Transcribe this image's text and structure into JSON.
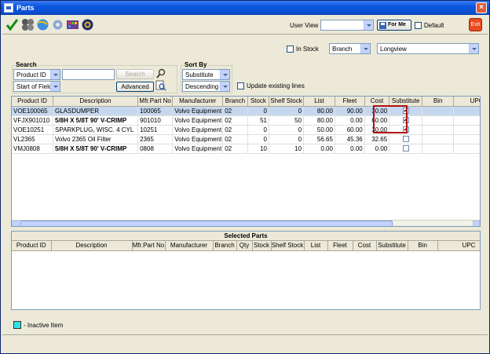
{
  "window": {
    "title": "Parts",
    "close": "×"
  },
  "toolbar": {
    "icons": [
      "check-icon",
      "coins-icon",
      "globe-icon",
      "gear-icon",
      "palette-icon",
      "color-wheel-icon"
    ],
    "user_view_label": "User View",
    "user_view_value": "",
    "for_me_label": "For Me",
    "default_label": "Default",
    "exit_label": "Exit"
  },
  "filter": {
    "in_stock_label": "In Stock",
    "branch_value": "Branch",
    "view_value": "Longview"
  },
  "search": {
    "title": "Search",
    "field_value": "Product ID",
    "match_value": "Start of Field",
    "query_value": "",
    "search_button": "Search",
    "advanced_button": "Advanced"
  },
  "sort": {
    "title": "Sort By",
    "field_value": "Substitute",
    "order_value": "Descending",
    "update_label": "Update existing lines"
  },
  "results": {
    "columns": [
      "Product ID",
      "Description",
      "Mfr.Part No",
      "Manufacturer",
      "Branch",
      "Stock",
      "Shelf Stock",
      "List",
      "Fleet",
      "Cost",
      "Substitute",
      "Bin",
      "UPC"
    ],
    "rows": [
      {
        "product_id": "VOE100065",
        "description": "GLASDUMPER",
        "mfr": "100065",
        "manufacturer": "Volvo Equipment",
        "branch": "02",
        "stock": "0",
        "shelf": "0",
        "list": "80.00",
        "fleet": "90.00",
        "cost": "30.00",
        "substitute": "✔",
        "bin": "",
        "upc": "",
        "bold": false,
        "selected": true
      },
      {
        "product_id": "VFJX901010",
        "description": "5/8H X 5/8T 90' V-CRIMP",
        "mfr": "901010",
        "manufacturer": "Volvo Equipment",
        "branch": "02",
        "stock": "51",
        "shelf": "50",
        "list": "80.00",
        "fleet": "0.00",
        "cost": "60.00",
        "substitute": "✔",
        "bin": "",
        "upc": "",
        "bold": true,
        "selected": false
      },
      {
        "product_id": "VOE10251",
        "description": "SPARKPLUG, WISC. 4 CYL",
        "mfr": "10251",
        "manufacturer": "Volvo Equipment",
        "branch": "02",
        "stock": "0",
        "shelf": "0",
        "list": "50.00",
        "fleet": "60.00",
        "cost": "30.00",
        "substitute": "✔",
        "bin": "",
        "upc": "",
        "bold": false,
        "selected": false
      },
      {
        "product_id": "VL2365",
        "description": "Volvo 2365 Oil Filter",
        "mfr": "2365",
        "manufacturer": "Volvo Equipment",
        "branch": "02",
        "stock": "0",
        "shelf": "0",
        "list": "56.65",
        "fleet": "45.36",
        "cost": "32.65",
        "substitute": "",
        "bin": "",
        "upc": "",
        "bold": false,
        "selected": false
      },
      {
        "product_id": "VMJ0808",
        "description": "5/8H X 5/8T 90' V-CRIMP",
        "mfr": "0808",
        "manufacturer": "Volvo Equipment",
        "branch": "02",
        "stock": "10",
        "shelf": "10",
        "list": "0.00",
        "fleet": "0.00",
        "cost": "0.00",
        "substitute": "",
        "bin": "",
        "upc": "",
        "bold": true,
        "selected": false
      }
    ]
  },
  "selected": {
    "title": "Selected Parts",
    "columns": [
      "Product ID",
      "Description",
      "Mfr.Part No",
      "Manufacturer",
      "Branch",
      "Qty",
      "Stock",
      "Shelf Stock",
      "List",
      "Fleet",
      "Cost",
      "Substitute",
      "Bin",
      "UPC"
    ]
  },
  "legend": {
    "label": "- Inactive Item",
    "color": "#2ee3e6"
  },
  "colors": {
    "highlight": "#b01010",
    "selected_row": "#c6d8ef"
  }
}
